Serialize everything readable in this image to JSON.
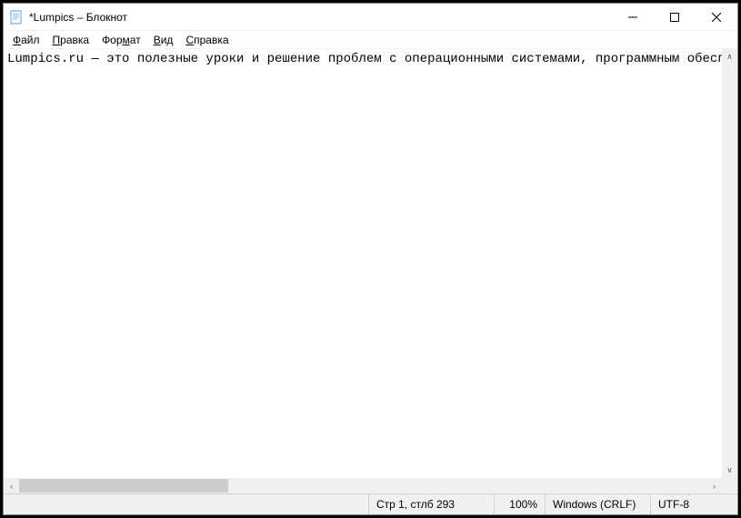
{
  "window": {
    "title": "*Lumpics – Блокнот"
  },
  "menu": {
    "file": {
      "pre": "",
      "u": "Ф",
      "post": "айл"
    },
    "edit": {
      "pre": "",
      "u": "П",
      "post": "равка"
    },
    "format": {
      "pre": "Фор",
      "u": "м",
      "post": "ат"
    },
    "view": {
      "pre": "",
      "u": "В",
      "post": "ид"
    },
    "help": {
      "pre": "",
      "u": "С",
      "post": "правка"
    }
  },
  "editor": {
    "text": "Lumpics.ru — это полезные уроки и решение проблем с операционными системами, программным обеспе"
  },
  "status": {
    "position": "Стр 1, стлб 293",
    "zoom": "100%",
    "eol": "Windows (CRLF)",
    "encoding": "UTF-8"
  }
}
